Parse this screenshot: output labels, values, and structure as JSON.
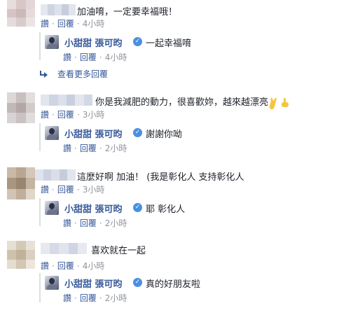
{
  "verified_symbol": "✓",
  "action_labels": {
    "like": "讚",
    "reply": "回覆"
  },
  "dot": "·",
  "comments": [
    {
      "text": "加油唷，一定要幸福哦！",
      "time": "4小時",
      "reply": {
        "author": "小甜甜 張可昀",
        "text": "一起幸福唷",
        "time": "4小時"
      },
      "more_replies": "查看更多回覆"
    },
    {
      "text": "你是我減肥的動力，很喜歡妳，越來越漂亮",
      "emojis": [
        "victory-hand",
        "pointing-hand"
      ],
      "time": "3小時",
      "reply": {
        "author": "小甜甜 張可昀",
        "text": "謝謝你呦",
        "time": "2小時"
      }
    },
    {
      "text": "這麼好啊 加油！ (我是彰化人 支持彰化人",
      "time": "3小時",
      "reply": {
        "author": "小甜甜 張可昀",
        "text": "耶 彰化人",
        "time": "2小時"
      }
    },
    {
      "text": "喜欢就在一起",
      "time": "4小時",
      "reply": {
        "author": "小甜甜 張可昀",
        "text": "真的好朋友啦",
        "time": "2小時"
      }
    }
  ],
  "colors": {
    "link": "#365899",
    "meta": "#90949c",
    "text": "#1d2129",
    "verified": "#4a90e2"
  }
}
